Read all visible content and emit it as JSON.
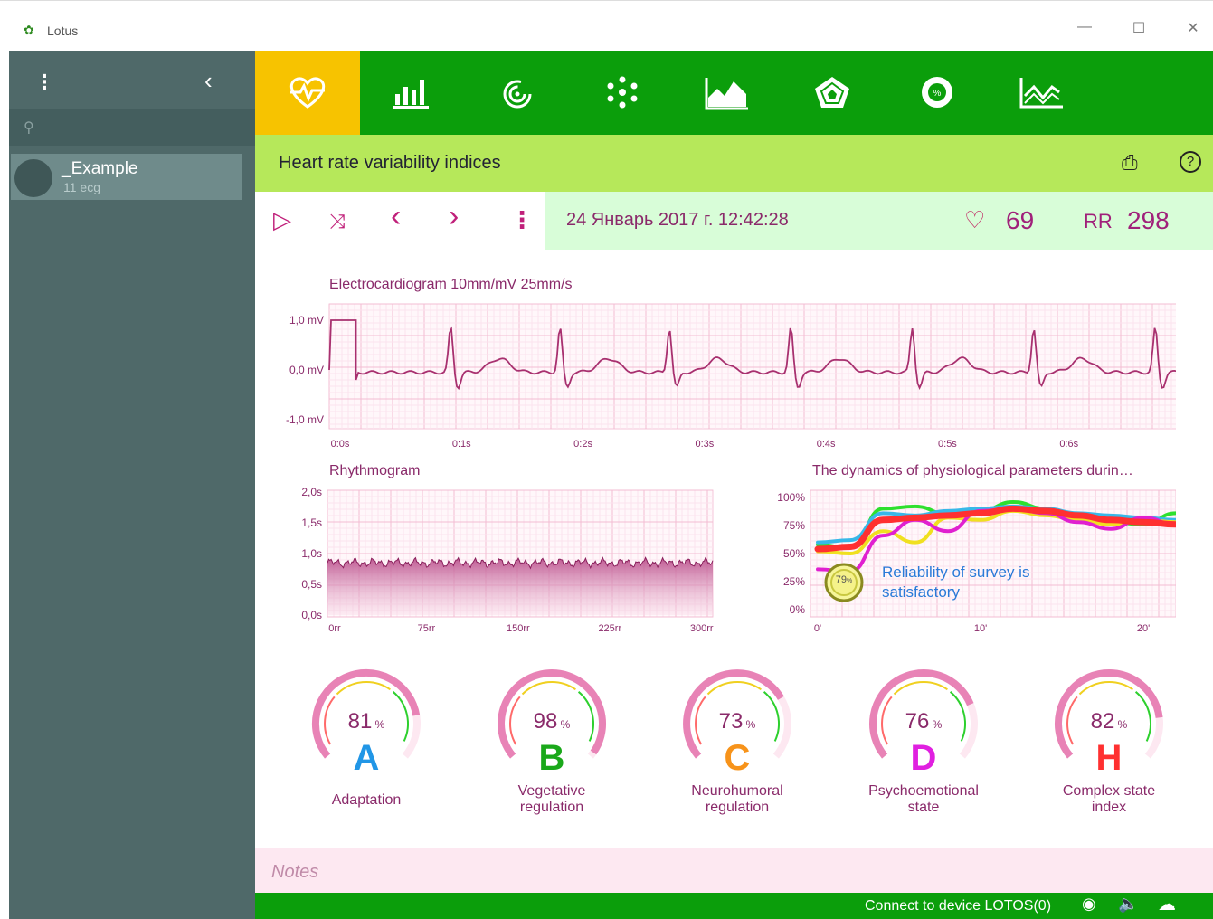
{
  "window": {
    "title": "Lotus",
    "logo_glyph": "✿",
    "minimize": "—",
    "maximize": "☐",
    "close": "✕"
  },
  "sidebar": {
    "menu_glyph": "⋮",
    "collapse_glyph": "‹",
    "search_glyph": "⚲",
    "item": {
      "name": "_Example",
      "sub": "11 ecg"
    }
  },
  "toolbar": {
    "tools": [
      {
        "icon": "heart-pulse-icon",
        "glyph": "♡"
      },
      {
        "icon": "bar-chart-icon",
        "glyph": "▁▃▅"
      },
      {
        "icon": "spiral-icon",
        "glyph": "◎"
      },
      {
        "icon": "molecule-icon",
        "glyph": "✺"
      },
      {
        "icon": "area-chart-icon",
        "glyph": "◭"
      },
      {
        "icon": "pentagon-radar-icon",
        "glyph": "⬟"
      },
      {
        "icon": "percent-circle-icon",
        "glyph": "%"
      },
      {
        "icon": "trend-chart-icon",
        "glyph": "⩘"
      }
    ]
  },
  "header": {
    "title": "Heart rate variability indices",
    "print_glyph": "⎙",
    "help_glyph": "?"
  },
  "nav": {
    "play_glyph": "▷",
    "shuffle_glyph": "⤨",
    "prev_glyph": "‹",
    "next_glyph": "›",
    "more_glyph": "⋮",
    "datetime": "24 Январь 2017 г. 12:42:28",
    "heart_glyph": "♡",
    "heart_rate": "69",
    "rr_label": "RR",
    "rr_value": "298"
  },
  "chart_data": [
    {
      "type": "line",
      "title": "Electrocardiogram 10mm/mV 25mm/s",
      "y_ticks": [
        "1,0 mV",
        "0,0 mV",
        "-1,0 mV"
      ],
      "x_ticks": [
        "0:0s",
        "0:1s",
        "0:2s",
        "0:3s",
        "0:4s",
        "0:5s",
        "0:6s"
      ],
      "ylim": [
        -1.0,
        1.0
      ],
      "r_peaks_s": [
        0.1,
        0.19,
        0.28,
        0.38,
        0.48,
        0.58,
        0.68
      ],
      "grid": true
    },
    {
      "type": "area",
      "title": "Rhythmogram",
      "y_ticks": [
        "2,0s",
        "1,5s",
        "1,0s",
        "0,5s",
        "0,0s"
      ],
      "x_ticks": [
        "0rr",
        "75rr",
        "150rr",
        "225rr",
        "300rr"
      ],
      "ylim": [
        0.0,
        2.0
      ],
      "mean_rr_s": 0.85,
      "grid": true
    },
    {
      "type": "line",
      "title": "The dynamics of physiological parameters durin…",
      "y_ticks": [
        "100%",
        "75%",
        "50%",
        "25%",
        "0%"
      ],
      "x_ticks": [
        "0'",
        "10'",
        "20'"
      ],
      "ylim": [
        0,
        100
      ],
      "x": [
        0,
        2,
        4,
        6,
        8,
        10,
        12,
        14,
        16,
        18,
        20,
        22
      ],
      "series": [
        {
          "color": "#2ee02e",
          "values": [
            58,
            55,
            90,
            92,
            85,
            88,
            96,
            90,
            82,
            78,
            76,
            86
          ]
        },
        {
          "color": "#38b8e8",
          "values": [
            60,
            62,
            86,
            84,
            88,
            90,
            92,
            90,
            86,
            84,
            82,
            80
          ]
        },
        {
          "color": "#f0e020",
          "values": [
            52,
            50,
            70,
            60,
            82,
            80,
            88,
            84,
            80,
            76,
            80,
            78
          ]
        },
        {
          "color": "#e020d0",
          "values": [
            36,
            34,
            66,
            80,
            70,
            88,
            90,
            86,
            78,
            72,
            82,
            76
          ]
        },
        {
          "color": "#ff3030",
          "values": [
            54,
            56,
            80,
            82,
            84,
            86,
            90,
            88,
            84,
            80,
            78,
            76
          ]
        }
      ],
      "reliability": {
        "value_label": "79",
        "unit": "%",
        "text": "Reliability of survey is satisfactory"
      },
      "grid": true
    }
  ],
  "gauges": [
    {
      "value": "81",
      "unit": "%",
      "letter": "A",
      "letter_color": "#2196e6",
      "label_line1": "Adaptation",
      "label_line2": "",
      "fraction": 0.81
    },
    {
      "value": "98",
      "unit": "%",
      "letter": "B",
      "letter_color": "#1aa81a",
      "label_line1": "Vegetative",
      "label_line2": "regulation",
      "fraction": 0.98
    },
    {
      "value": "73",
      "unit": "%",
      "letter": "C",
      "letter_color": "#f7931a",
      "label_line1": "Neurohumoral",
      "label_line2": "regulation",
      "fraction": 0.73
    },
    {
      "value": "76",
      "unit": "%",
      "letter": "D",
      "letter_color": "#e020e0",
      "label_line1": "Psychoemotional",
      "label_line2": "state",
      "fraction": 0.76
    },
    {
      "value": "82",
      "unit": "%",
      "letter": "H",
      "letter_color": "#ff3030",
      "label_line1": "Complex state",
      "label_line2": "index",
      "fraction": 0.82
    }
  ],
  "notes": {
    "placeholder": "Notes"
  },
  "footer": {
    "status": "Connect to device LOTOS(0)",
    "record_glyph": "◉",
    "sound_glyph": "🔈",
    "cloud_glyph": "☁"
  },
  "colors": {
    "sidebar": "#4f6969",
    "toolbar": "#0b9e0b",
    "active_tool": "#f7c300",
    "header": "#b6e85a",
    "infobar": "#d8fdd8",
    "accent": "#a0207a"
  }
}
